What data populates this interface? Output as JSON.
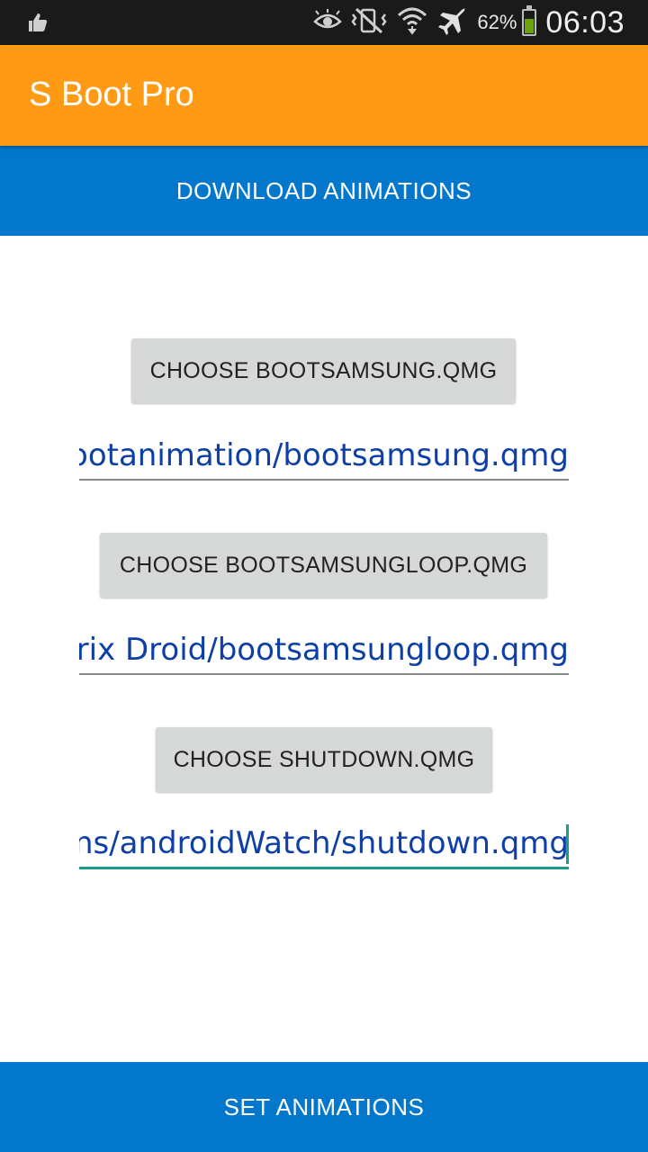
{
  "status_bar": {
    "notification_icon": "thumbs-up-icon",
    "icons": [
      "eye-icon",
      "vibrate-icon",
      "wifi-icon",
      "airplane-icon"
    ],
    "battery_percent": "62%",
    "battery_level": 0.62,
    "time": "06:03"
  },
  "app_bar": {
    "title": "S Boot Pro",
    "color": "#ff9a14"
  },
  "download_button": {
    "label": "DOWNLOAD ANIMATIONS",
    "color": "#0277cc"
  },
  "sections": [
    {
      "button_label": "CHOOSE BOOTSAMSUNG.QMG",
      "path_value": "/sdcard/Bootanimation/bootsamsung.qmg"
    },
    {
      "button_label": "CHOOSE BOOTSAMSUNGLOOP.QMG",
      "path_value": "Matrix Droid/bootsamsungloop.qmg"
    },
    {
      "button_label": "CHOOSE SHUTDOWN.QMG",
      "path_value": "Animations/androidWatch/shutdown.qmg"
    }
  ],
  "set_button": {
    "label": "SET ANIMATIONS",
    "color": "#0277cc"
  },
  "accent_color": "#1a9b8c"
}
